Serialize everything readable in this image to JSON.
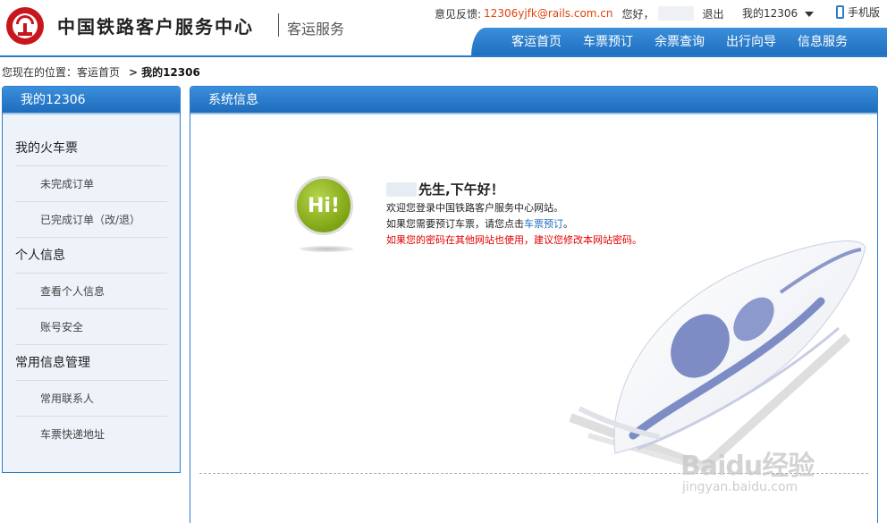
{
  "header": {
    "site_name": "中国铁路客户服务中心",
    "site_sub": "客运服务",
    "feedback_label": "意见反馈:",
    "feedback_email": "12306yjfk@rails.com.cn",
    "greeting": "您好，",
    "logout": "退出",
    "my12306": "我的12306",
    "mobile": "手机版",
    "nav": [
      "客运首页",
      "车票预订",
      "余票查询",
      "出行向导",
      "信息服务"
    ]
  },
  "breadcrumb": {
    "prefix": "您现在的位置：客运首页",
    "sep": ">",
    "current": "我的12306"
  },
  "sidebar": {
    "title": "我的12306",
    "groups": [
      {
        "label": "我的火车票",
        "items": [
          "未完成订单",
          "已完成订单（改/退）"
        ]
      },
      {
        "label": "个人信息",
        "items": [
          "查看个人信息",
          "账号安全"
        ]
      },
      {
        "label": "常用信息管理",
        "items": [
          "常用联系人",
          "车票快递地址"
        ]
      }
    ]
  },
  "main": {
    "title": "系统信息",
    "hi": "Hi!",
    "hello": "先生,下午好！",
    "line1": "欢迎您登录中国铁路客户服务中心网站。",
    "line2_pre": "如果您需要预订车票，请您点击",
    "line2_link": "车票预订",
    "line2_post": "。",
    "warning": "如果您的密码在其他网站也使用，建议您修改本网站密码。"
  },
  "watermark": {
    "main": "Baidu经验",
    "sub": "jingyan.baidu.com"
  },
  "colors": {
    "brand_blue": "#1f6fbf",
    "link": "#1f6fbf",
    "email": "#e0430c",
    "warning": "#e10000",
    "hi_green": "#7ea312"
  },
  "icons": [
    "railway-logo-icon",
    "phone-icon",
    "caret-down-icon",
    "hi-badge-icon",
    "train-illustration-icon"
  ]
}
